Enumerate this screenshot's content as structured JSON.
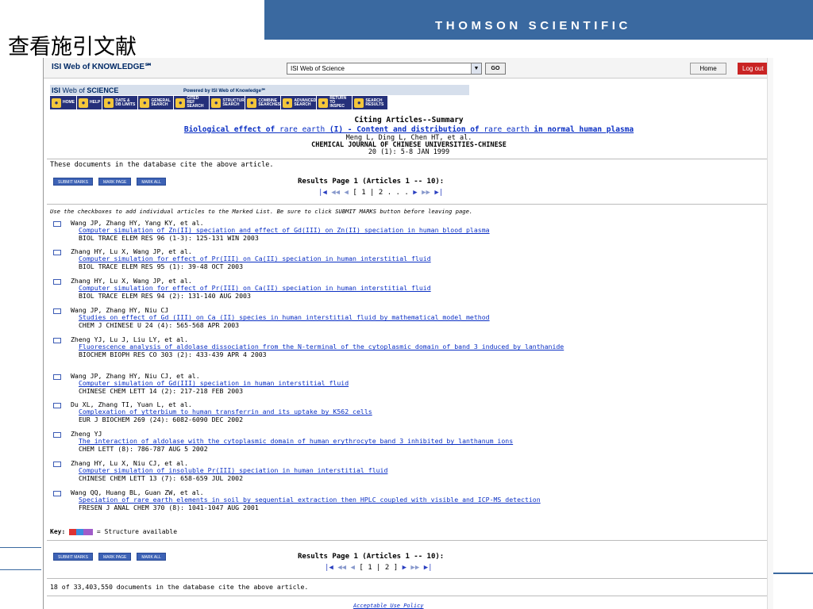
{
  "slide": {
    "brand": "THOMSON SCIENTIFIC",
    "title": "查看施引文献"
  },
  "topbar": {
    "logo": "ISI Web of KNOWLEDGE℠",
    "database_select": "ISI Web of Science",
    "go_label": "GO",
    "home_label": "Home",
    "logout_label": "Log out"
  },
  "wos": {
    "logo_isi": "ISI",
    "logo_web": "Web of",
    "logo_science": "SCIENCE",
    "powered": "Powered by ISI Web of Knowledge℠",
    "toolbar": [
      {
        "label": "HOME",
        "icon": "home-icon"
      },
      {
        "label": "HELP",
        "icon": "help-icon"
      },
      {
        "label": "DATE & DB LIMITS",
        "icon": "limits-icon"
      },
      {
        "label": "GENERAL SEARCH",
        "icon": "general-search-icon"
      },
      {
        "label": "CITED REF SEARCH",
        "icon": "cited-ref-icon"
      },
      {
        "label": "STRUCTURE SEARCH",
        "icon": "structure-icon"
      },
      {
        "label": "COMBINE SEARCHES",
        "icon": "combine-icon"
      },
      {
        "label": "ADVANCED SEARCH",
        "icon": "advanced-icon"
      },
      {
        "label": "RETURN TO INSPEC",
        "icon": "return-icon"
      },
      {
        "label": "SEARCH RESULTS",
        "icon": "results-icon"
      }
    ]
  },
  "summary": {
    "heading": "Citing Articles--Summary",
    "title_parts": [
      {
        "text": "Biological effect of ",
        "bold": true
      },
      {
        "text": "rare earth",
        "bold": false
      },
      {
        "text": " (I) - Content and distribution of ",
        "bold": true
      },
      {
        "text": "rare earth",
        "bold": false
      },
      {
        "text": " in normal human plasma",
        "bold": true
      }
    ],
    "authors": "Meng L, Ding L, Chen HT, et al.",
    "journal": "CHEMICAL JOURNAL OF CHINESE UNIVERSITIES-CHINESE",
    "issue": "20 (1): 5-8 JAN 1999",
    "cite_note": "These documents in the database cite the above article."
  },
  "buttons": {
    "submit": "SUBMIT MARKS",
    "mark_page": "MARK PAGE",
    "mark_all": "MARK ALL"
  },
  "results": {
    "label": "Results Page 1 (Articles 1 -- 10):",
    "pager_top": "[ 1 | 2 . . .",
    "pager_bottom": "[ 1 | 2 ]"
  },
  "instructions": "Use the checkboxes to add individual articles to the Marked List. Be sure to click SUBMIT MARKS button before leaving page.",
  "records": [
    {
      "authors": "Wang JP, Zhang HY, Yang KY, et al.",
      "title": "Computer simulation of Zn(II) speciation and effect of Gd(III) on Zn(II) speciation in human blood plasma",
      "source": "BIOL TRACE ELEM RES 96 (1-3): 125-131 WIN 2003"
    },
    {
      "authors": "Zhang HY, Lu X, Wang JP, et al.",
      "title": "Computer simulation for effect of Pr(III) on Ca(II) speciation in human interstitial fluid",
      "source": "BIOL TRACE ELEM RES 95 (1): 39-48 OCT 2003"
    },
    {
      "authors": "Zhang HY, Lu X, Wang JP, et al.",
      "title": "Computer simulation for effect of Pr(III) on Ca(II) speciation in human interstitial fluid",
      "source": "BIOL TRACE ELEM RES 94 (2): 131-140 AUG 2003"
    },
    {
      "authors": "Wang JP, Zhang HY, Niu CJ",
      "title": "Studies on effect of Gd (III) on Ca (II) species in human interstitial fluid by mathematical model method",
      "source": "CHEM J CHINESE U 24 (4): 565-568 APR 2003"
    },
    {
      "authors": "Zheng YJ, Lu J, Liu LY, et al.",
      "title": "Fluorescence analysis of aldolase dissociation from the N-terminal of the cytoplasmic domain of band 3 induced by lanthanide",
      "source": "BIOCHEM BIOPH RES CO 303 (2): 433-439 APR 4 2003"
    },
    {
      "authors": "Wang JP, Zhang HY, Niu CJ, et al.",
      "title": "Computer simulation of Gd(III) speciation in human interstitial fluid",
      "source": "CHINESE CHEM LETT 14 (2): 217-218 FEB 2003"
    },
    {
      "authors": "Du XL, Zhang TI, Yuan L, et al.",
      "title": "Complexation of ytterbium to human transferrin and its uptake by K562 cells",
      "source": "EUR J BIOCHEM 269 (24): 6082-6090 DEC 2002"
    },
    {
      "authors": "Zheng YJ",
      "title": "The interaction of aldolase with the cytoplasmic domain of human erythrocyte band 3 inhibited by lanthanum ions",
      "source": "CHEM LETT (8): 786-787 AUG 5 2002"
    },
    {
      "authors": "Zhang HY, Lu X, Niu CJ, et al.",
      "title": "Computer simulation of insoluble Pr(III) speciation in human interstitial fluid",
      "source": "CHINESE CHEM LETT 13 (7): 658-659 JUL 2002"
    },
    {
      "authors": "Wang QQ, Huang BL, Guan ZW, et al.",
      "title": "Speciation of rare earth elements in soil by sequential extraction then HPLC coupled with visible and ICP-MS detection",
      "source": "FRESEN J ANAL CHEM 370 (8): 1041-1047 AUG 2001"
    }
  ],
  "key": {
    "label": "Key:",
    "text": "= Structure available"
  },
  "bottom_count": "18 of 33,403,550 documents in the database cite the above article.",
  "footer_link": "Acceptable Use Policy"
}
